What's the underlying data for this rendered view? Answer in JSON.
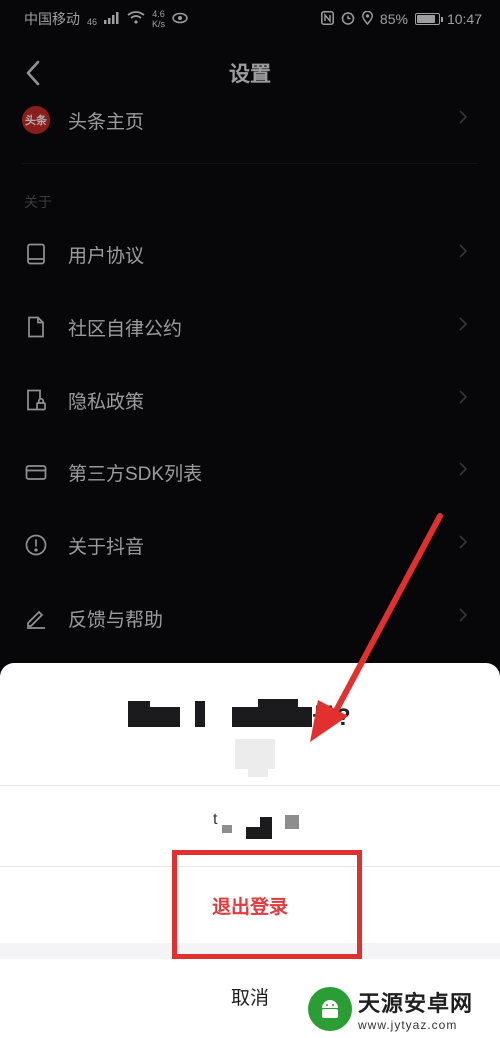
{
  "status_bar": {
    "carrier": "中国移动",
    "network": "46",
    "speed_value": "4.6",
    "speed_unit": "K/s",
    "battery": "85%",
    "time": "10:47"
  },
  "nav": {
    "title": "设置"
  },
  "rows_top": [
    {
      "label": "头条主页",
      "icon": "toutiao-logo"
    }
  ],
  "section_about": {
    "header": "关于"
  },
  "about_rows": [
    {
      "label": "用户协议",
      "icon": "book-icon"
    },
    {
      "label": "社区自律公约",
      "icon": "document-icon"
    },
    {
      "label": "隐私政策",
      "icon": "privacy-lock-icon"
    },
    {
      "label": "第三方SDK列表",
      "icon": "sdk-box-icon"
    },
    {
      "label": "关于抖音",
      "icon": "info-circle-icon"
    },
    {
      "label": "反馈与帮助",
      "icon": "pencil-icon"
    }
  ],
  "toutiao_logo_text": "头条",
  "sheet": {
    "title_visible_suffix": "号?",
    "account_prefix": "t",
    "logout_label": "退出登录",
    "cancel_label": "取消"
  },
  "watermark": {
    "name": "天源安卓网",
    "url": "www.jytyaz.com"
  },
  "colors": {
    "background": "#0b0b0e",
    "logout_red": "#e4393c",
    "annotation_red": "#e1302e",
    "watermark_green": "#2a9d34"
  }
}
